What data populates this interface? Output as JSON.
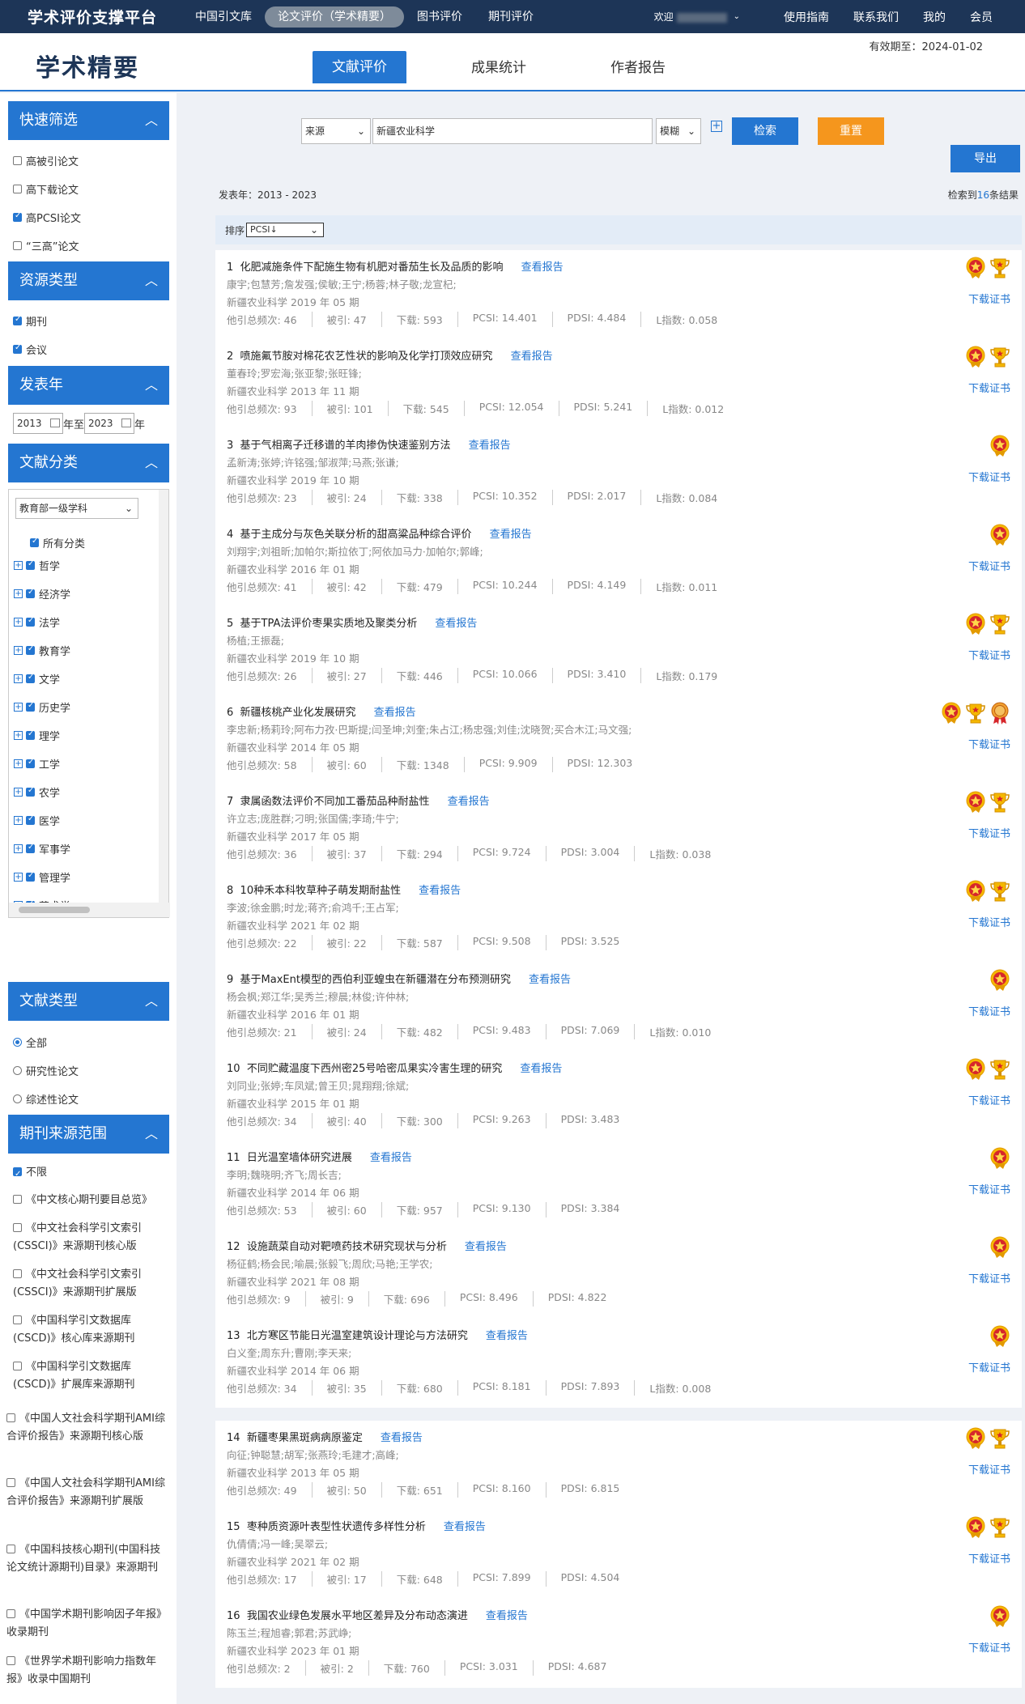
{
  "nav": {
    "brand": "学术评价支撑平台",
    "links": [
      "中国引文库",
      "论文评价（学术精要）",
      "图书评价",
      "期刊评价"
    ],
    "welcome": "欢迎",
    "right": [
      "使用指南",
      "联系我们",
      "我的",
      "会员"
    ]
  },
  "header": {
    "logo": "学术精要",
    "valid_until": "有效期至：2024-01-02",
    "tabs": [
      "文献评价",
      "成果统计",
      "作者报告"
    ]
  },
  "sidebar": {
    "quick": {
      "title": "快速筛选",
      "items": [
        {
          "label": "高被引论文",
          "checked": false
        },
        {
          "label": "高下载论文",
          "checked": false
        },
        {
          "label": "高PCSI论文",
          "checked": true
        },
        {
          "label": "“三高”论文",
          "checked": false
        }
      ]
    },
    "resource": {
      "title": "资源类型",
      "items": [
        {
          "label": "期刊",
          "checked": true
        },
        {
          "label": "会议",
          "checked": true
        }
      ]
    },
    "year": {
      "title": "发表年",
      "from": "2013",
      "mid": "年至",
      "to": "2023",
      "end": "年"
    },
    "classify": {
      "title": "文献分类",
      "select": "教育部一级学科",
      "items": [
        "所有分类",
        "哲学",
        "经济学",
        "法学",
        "教育学",
        "文学",
        "历史学",
        "理学",
        "工学",
        "农学",
        "医学",
        "军事学",
        "管理学",
        "艺术学"
      ]
    },
    "doctype": {
      "title": "文献类型",
      "items": [
        {
          "label": "全部",
          "checked": true
        },
        {
          "label": "研究性论文",
          "checked": false
        },
        {
          "label": "综述性论文",
          "checked": false
        }
      ]
    },
    "source": {
      "title": "期刊来源范围",
      "items": [
        {
          "label": "不限",
          "checked": true
        },
        {
          "label": "《中文核心期刊要目总览》",
          "checked": false
        },
        {
          "label": "《中文社会科学引文索引(CSSCI)》来源期刊核心版",
          "checked": false
        },
        {
          "label": "《中文社会科学引文索引(CSSCI)》来源期刊扩展版",
          "checked": false
        },
        {
          "label": "《中国科学引文数据库(CSCD)》核心库来源期刊",
          "checked": false
        },
        {
          "label": "《中国科学引文数据库(CSCD)》扩展库来源期刊",
          "checked": false
        },
        {
          "label": "《中国人文社会科学期刊AMI综合评价报告》来源期刊核心版",
          "checked": false
        },
        {
          "label": "《中国人文社会科学期刊AMI综合评价报告》来源期刊扩展版",
          "checked": false
        },
        {
          "label": "《中国科技核心期刊(中国科技论文统计源期刊)目录》来源期刊",
          "checked": false
        },
        {
          "label": "《中国学术期刊影响因子年报》收录期刊",
          "checked": false
        },
        {
          "label": "《世界学术期刊影响力指数年报》收录中国期刊",
          "checked": false
        }
      ]
    }
  },
  "search": {
    "field": "来源",
    "query": "新疆农业科学",
    "mode": "模糊",
    "search_label": "检索",
    "reset_label": "重置",
    "export_label": "导出"
  },
  "summary": {
    "years": "发表年：2013 - 2023",
    "count_prefix": "检索到",
    "count": "16",
    "count_suffix": "条结果",
    "sort_label": "排序",
    "sort_value": "PCSI↓"
  },
  "results": [
    {
      "n": "1",
      "title": "化肥减施条件下配施生物有机肥对番茄生长及品质的影响",
      "authors": "康宇;包慧芳;詹发强;侯敏;王宁;杨蓉;林子敬;龙宣杞;",
      "src": "新疆农业科学 2019 年 05 期",
      "stats": [
        "他引总频次: 46",
        "被引: 47",
        "下载: 593",
        "PCSI: 14.401",
        "PDSI: 4.484",
        "L指数: 0.058"
      ],
      "badges": [
        "star",
        "cup"
      ]
    },
    {
      "n": "2",
      "title": "喷施氟节胺对棉花农艺性状的影响及化学打顶效应研究",
      "authors": "董春玲;罗宏海;张亚黎;张旺锋;",
      "src": "新疆农业科学 2013 年 11 期",
      "stats": [
        "他引总频次: 93",
        "被引: 101",
        "下载: 545",
        "PCSI: 12.054",
        "PDSI: 5.241",
        "L指数: 0.012"
      ],
      "badges": [
        "star",
        "cup"
      ]
    },
    {
      "n": "3",
      "title": "基于气相离子迁移谱的羊肉掺伪快速鉴别方法",
      "authors": "孟新涛;张婷;许铭强;邹淑萍;马燕;张谦;",
      "src": "新疆农业科学 2019 年 10 期",
      "stats": [
        "他引总频次: 23",
        "被引: 24",
        "下载: 338",
        "PCSI: 10.352",
        "PDSI: 2.017",
        "L指数: 0.084"
      ],
      "badges": [
        "star"
      ]
    },
    {
      "n": "4",
      "title": "基于主成分与灰色关联分析的甜高粱品种综合评价",
      "authors": "刘翔宇;刘祖昕;加帕尔;斯拉依丁;阿依加马力·加帕尔;郭峰;",
      "src": "新疆农业科学 2016 年 01 期",
      "stats": [
        "他引总频次: 41",
        "被引: 42",
        "下载: 479",
        "PCSI: 10.244",
        "PDSI: 4.149",
        "L指数: 0.011"
      ],
      "badges": [
        "star"
      ]
    },
    {
      "n": "5",
      "title": "基于TPA法评价枣果实质地及聚类分析",
      "authors": "杨植;王振磊;",
      "src": "新疆农业科学 2019 年 10 期",
      "stats": [
        "他引总频次: 26",
        "被引: 27",
        "下载: 446",
        "PCSI: 10.066",
        "PDSI: 3.410",
        "L指数: 0.179"
      ],
      "badges": [
        "star",
        "cup"
      ]
    },
    {
      "n": "6",
      "title": "新疆核桃产业化发展研究",
      "authors": "李忠新;杨莉玲;阿布力孜·巴斯提;闫圣坤;刘奎;朱占江;杨忠强;刘佳;沈晓贺;买合木江;马文强;",
      "src": "新疆农业科学 2014 年 05 期",
      "stats": [
        "他引总频次: 58",
        "被引: 60",
        "下载: 1348",
        "PCSI: 9.909",
        "PDSI: 12.303"
      ],
      "badges": [
        "star",
        "cup",
        "medal"
      ]
    },
    {
      "n": "7",
      "title": "隶属函数法评价不同加工番茄品种耐盐性",
      "authors": "许立志;庞胜群;刁明;张国儒;李琦;牛宁;",
      "src": "新疆农业科学 2017 年 05 期",
      "stats": [
        "他引总频次: 36",
        "被引: 37",
        "下载: 294",
        "PCSI: 9.724",
        "PDSI: 3.004",
        "L指数: 0.038"
      ],
      "badges": [
        "star",
        "cup"
      ]
    },
    {
      "n": "8",
      "title": "10种禾本科牧草种子萌发期耐盐性",
      "authors": "李波;徐金鹏;时龙;蒋齐;俞鸿千;王占军;",
      "src": "新疆农业科学 2021 年 02 期",
      "stats": [
        "他引总频次: 22",
        "被引: 22",
        "下载: 587",
        "PCSI: 9.508",
        "PDSI: 3.525"
      ],
      "badges": [
        "star",
        "cup"
      ]
    },
    {
      "n": "9",
      "title": "基于MaxEnt模型的西伯利亚蝗虫在新疆潜在分布预测研究",
      "authors": "杨会枫;郑江华;吴秀兰;穆晨;林俊;许仲林;",
      "src": "新疆农业科学 2016 年 01 期",
      "stats": [
        "他引总频次: 21",
        "被引: 24",
        "下载: 482",
        "PCSI: 9.483",
        "PDSI: 7.069",
        "L指数: 0.010"
      ],
      "badges": [
        "star"
      ]
    },
    {
      "n": "10",
      "title": "不同贮藏温度下西州密25号哈密瓜果实冷害生理的研究",
      "authors": "刘同业;张婷;车凤斌;曾王贝;晁翔翔;徐斌;",
      "src": "新疆农业科学 2015 年 01 期",
      "stats": [
        "他引总频次: 34",
        "被引: 40",
        "下载: 300",
        "PCSI: 9.263",
        "PDSI: 3.483"
      ],
      "badges": [
        "star",
        "cup"
      ]
    },
    {
      "n": "11",
      "title": "日光温室墙体研究进展",
      "authors": "李明;魏晓明;齐飞;周长吉;",
      "src": "新疆农业科学 2014 年 06 期",
      "stats": [
        "他引总频次: 53",
        "被引: 60",
        "下载: 957",
        "PCSI: 9.130",
        "PDSI: 3.384"
      ],
      "badges": [
        "star"
      ]
    },
    {
      "n": "12",
      "title": "设施蔬菜自动对靶喷药技术研究现状与分析",
      "authors": "杨征鹤;杨会民;喻晨;张毅飞;周欣;马艳;王学农;",
      "src": "新疆农业科学 2021 年 08 期",
      "stats": [
        "他引总频次: 9",
        "被引: 9",
        "下载: 696",
        "PCSI: 8.496",
        "PDSI: 4.822"
      ],
      "badges": [
        "star"
      ]
    },
    {
      "n": "13",
      "title": "北方寒区节能日光温室建筑设计理论与方法研究",
      "authors": "白义奎;周东升;曹刚;李天来;",
      "src": "新疆农业科学 2014 年 06 期",
      "stats": [
        "他引总频次: 34",
        "被引: 35",
        "下载: 680",
        "PCSI: 8.181",
        "PDSI: 7.893",
        "L指数: 0.008"
      ],
      "badges": [
        "star"
      ]
    },
    {
      "n": "14",
      "title": "新疆枣果黑斑病病原鉴定",
      "authors": "向征;钟聪慧;胡军;张燕玲;毛建才;高峰;",
      "src": "新疆农业科学 2013 年 05 期",
      "stats": [
        "他引总频次: 49",
        "被引: 50",
        "下载: 651",
        "PCSI: 8.160",
        "PDSI: 6.815"
      ],
      "badges": [
        "star",
        "cup"
      ]
    },
    {
      "n": "15",
      "title": "枣种质资源叶表型性状遗传多样性分析",
      "authors": "仇倩倩;冯一峰;吴翠云;",
      "src": "新疆农业科学 2021 年 02 期",
      "stats": [
        "他引总频次: 17",
        "被引: 17",
        "下载: 648",
        "PCSI: 7.899",
        "PDSI: 4.504"
      ],
      "badges": [
        "star",
        "cup"
      ]
    },
    {
      "n": "16",
      "title": "我国农业绿色发展水平地区差异及分布动态演进",
      "authors": "陈玉兰;程旭睿;郭君;苏武峥;",
      "src": "新疆农业科学 2023 年 01 期",
      "stats": [
        "他引总频次: 2",
        "被引: 2",
        "下载: 760",
        "PCSI: 3.031",
        "PDSI: 4.687"
      ],
      "badges": [
        "star"
      ]
    }
  ],
  "labels": {
    "report": "查看报告",
    "cert": "下载证书"
  },
  "colors": {
    "primary": "#2476d1",
    "nav": "#1d3557",
    "orange": "#f5961d"
  }
}
